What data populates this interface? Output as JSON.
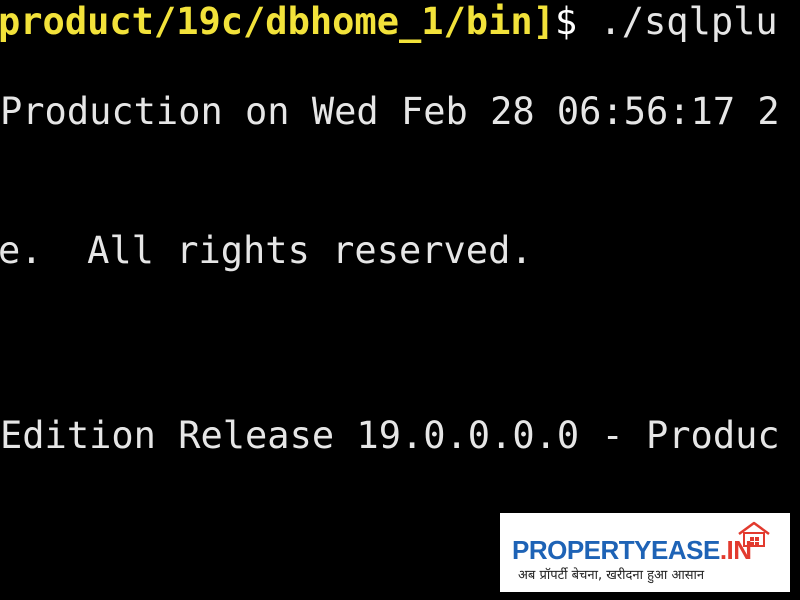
{
  "terminal": {
    "prompt_path": "product/19c/dbhome_1/bin]",
    "prompt_symbol": "$",
    "command": " ./sqlplu",
    "line2": "Production on Wed Feb 28 06:56:17 2",
    "line3": "e.  All rights reserved.",
    "line4": "Edition Release 19.0.0.0.0 - Produc"
  },
  "watermark": {
    "brand_main": "PROPERTYEASE",
    "brand_suffix": ".IN",
    "tagline": "अब प्रॉपर्टी बेचना, खरीदना हुआ आसान"
  },
  "colors": {
    "background": "#000000",
    "prompt": "#f2e23a",
    "text": "#e6e6e6",
    "brand_blue": "#1e63b6",
    "brand_red": "#e23a2e"
  }
}
